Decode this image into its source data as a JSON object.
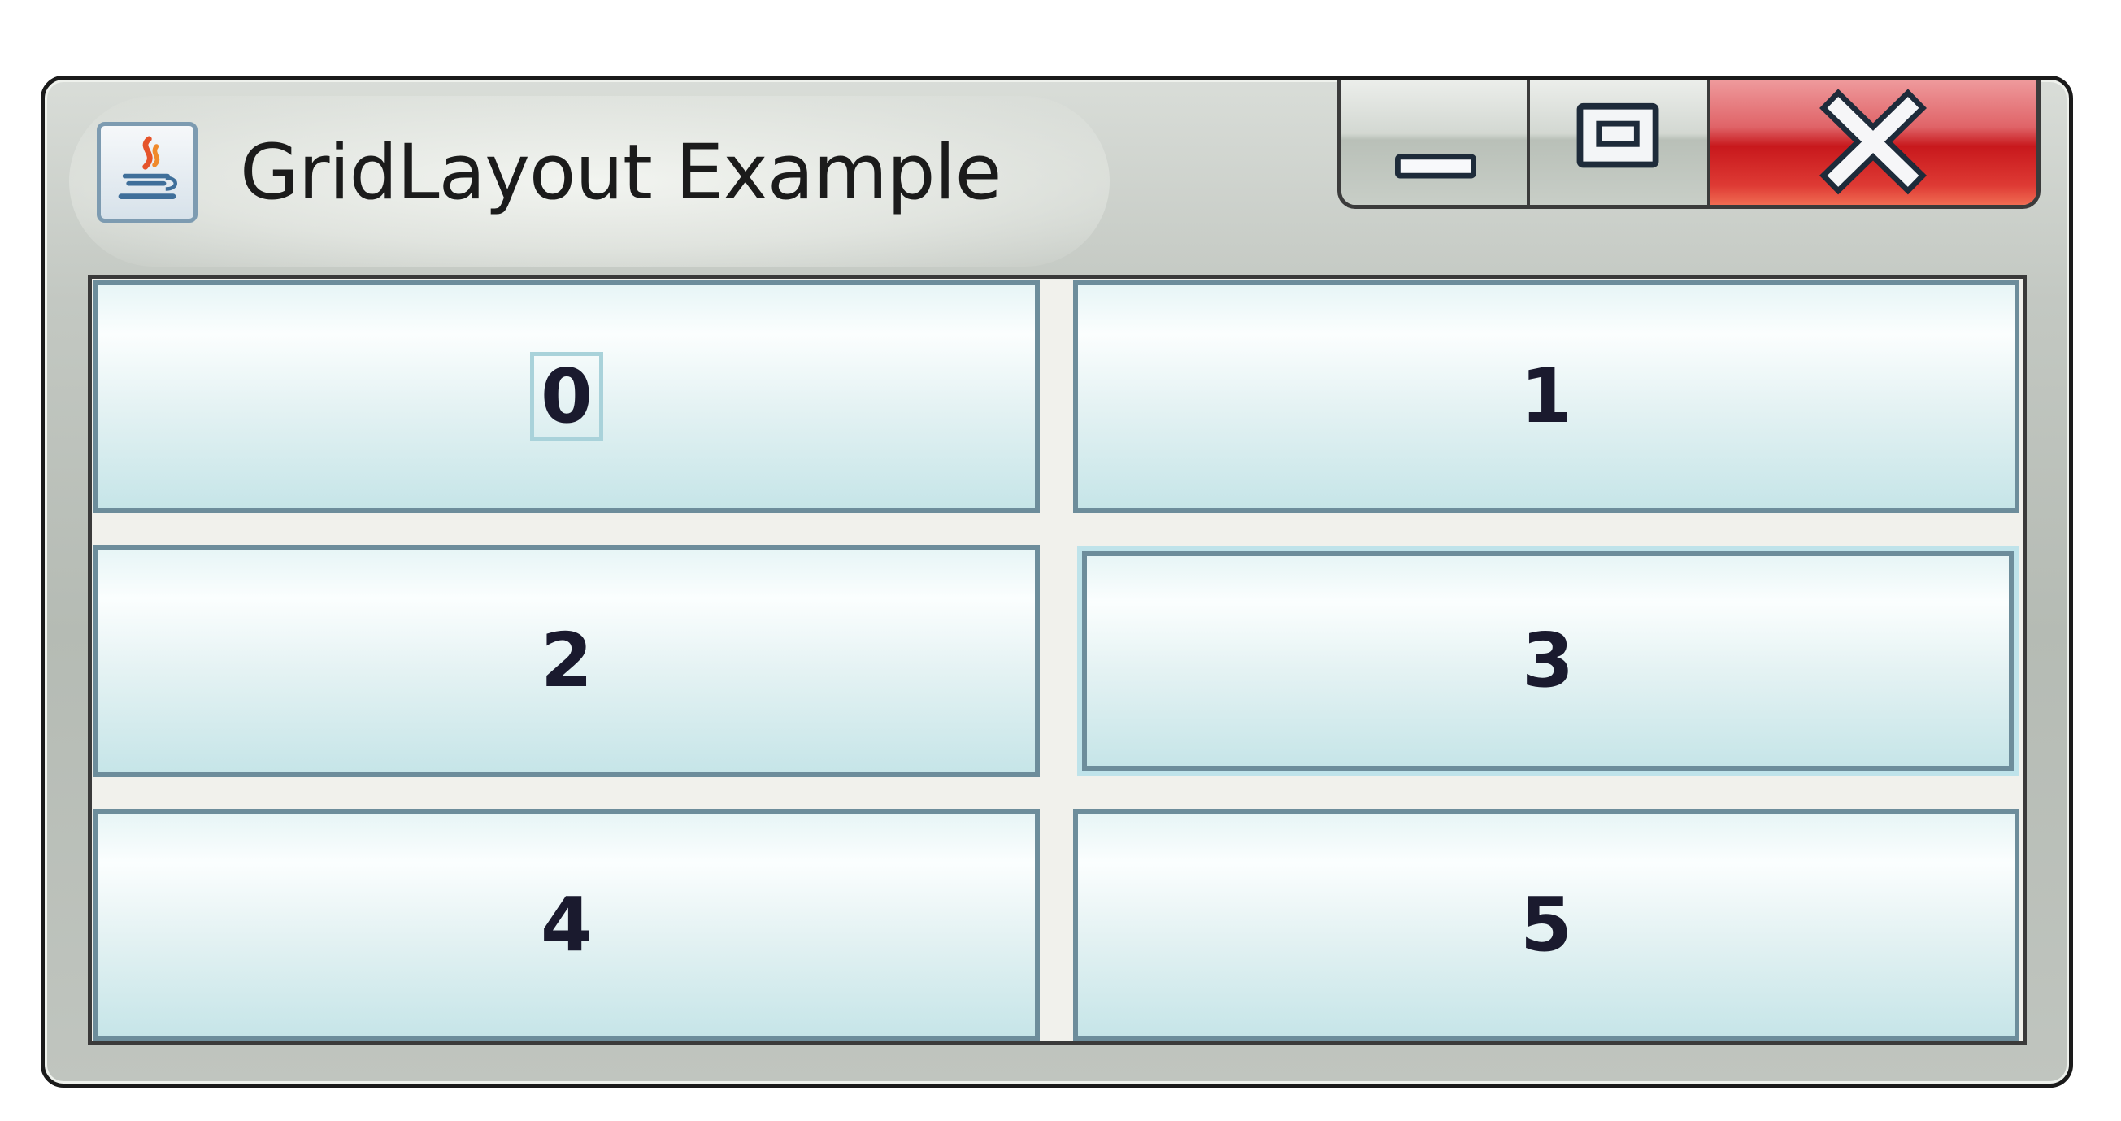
{
  "window": {
    "title": "GridLayout Example",
    "app_icon": "java-cup-icon"
  },
  "caption_buttons": {
    "minimize_icon": "minimize-icon",
    "maximize_icon": "restore-icon",
    "close_icon": "close-icon",
    "close_color": "#c8181c"
  },
  "grid": {
    "rows": 3,
    "columns": 2,
    "buttons": [
      {
        "label": "0",
        "focused": true
      },
      {
        "label": "1",
        "focused": false
      },
      {
        "label": "2",
        "focused": false
      },
      {
        "label": "3",
        "focused": false
      },
      {
        "label": "4",
        "focused": false
      },
      {
        "label": "5",
        "focused": false
      }
    ]
  },
  "colors": {
    "button_border": "#6d8d9b",
    "button_fill_top": "#fbfefe",
    "button_fill_bottom": "#c6e5e8",
    "panel_background": "#f1f1ec"
  }
}
